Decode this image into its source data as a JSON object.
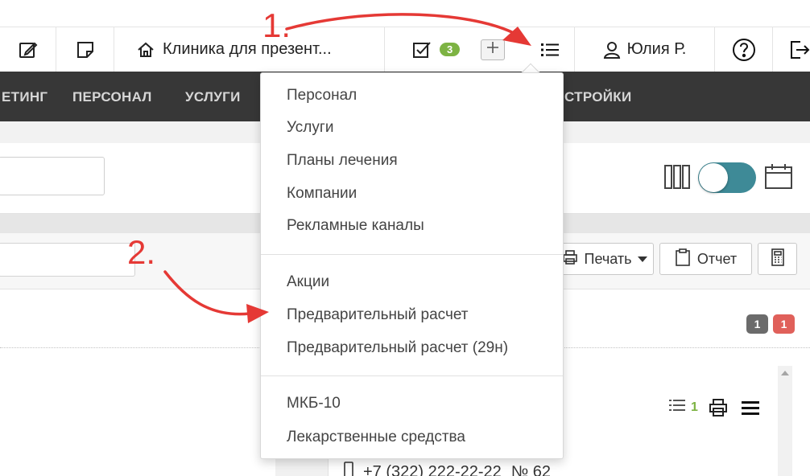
{
  "topbar": {
    "clinic_name": "Клиника для презент...",
    "tasks_count": "3",
    "user_name": "Юлия Р."
  },
  "nav": {
    "items": [
      {
        "label": "ЕТИНГ"
      },
      {
        "label": "ПЕРСОНАЛ"
      },
      {
        "label": "УСЛУГИ"
      },
      {
        "label": "СТРОЙКИ"
      }
    ]
  },
  "toolbar": {
    "print_label": "Печать",
    "report_label": "Отчет"
  },
  "badges": {
    "gray_count": "1",
    "red_count": "1"
  },
  "panel": {
    "list_count": "1",
    "phone": "+7 (322) 222-22-22",
    "number": "№ 62"
  },
  "dropdown": {
    "group1": [
      "Персонал",
      "Услуги",
      "Планы лечения",
      "Компании",
      "Рекламные каналы"
    ],
    "group2": [
      "Акции",
      "Предварительный расчет",
      "Предварительный расчет (29н)"
    ],
    "group3": [
      "МКБ-10",
      "Лекарственные средства"
    ]
  },
  "annotations": {
    "step1": "1.",
    "step2": "2."
  },
  "colors": {
    "accent_green": "#7db343",
    "toggle_teal": "#3e8a97",
    "annotation_red": "#e53935",
    "nav_bg": "#373737"
  }
}
